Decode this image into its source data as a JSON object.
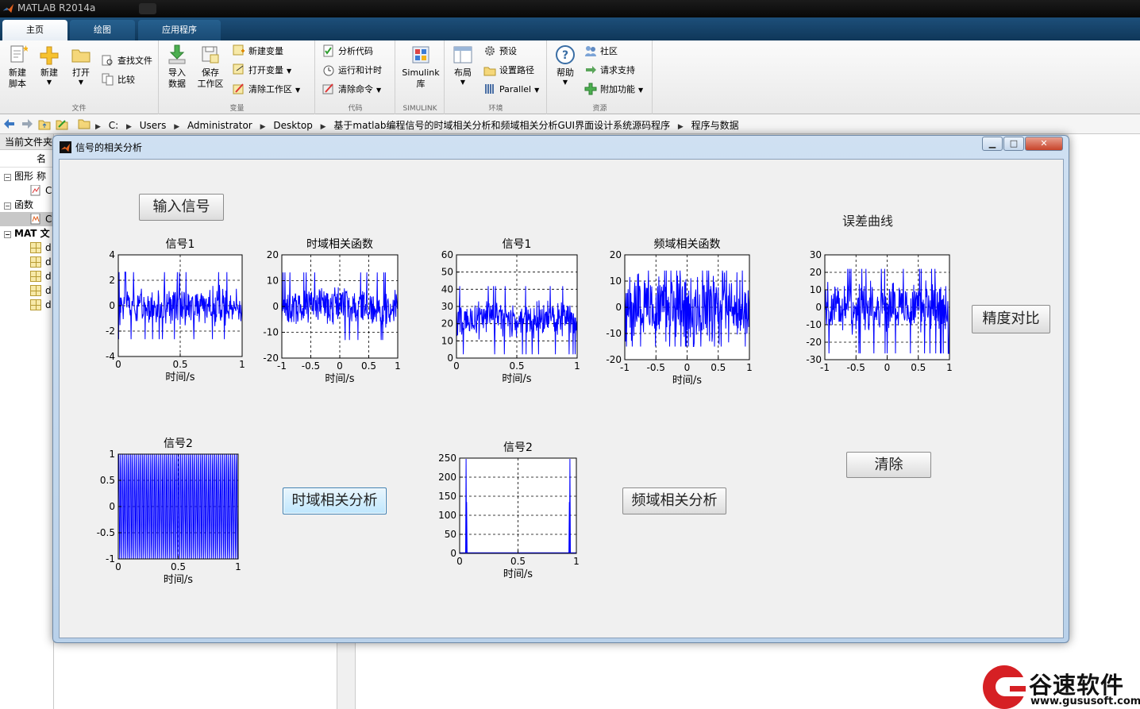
{
  "app": {
    "title": "MATLAB R2014a"
  },
  "ribbon": {
    "tabs": [
      "主页",
      "绘图",
      "应用程序"
    ],
    "file_group": {
      "label": "文件",
      "new_script": "新建\n脚本",
      "new": "新建",
      "open": "打开",
      "find_files": "查找文件",
      "compare": "比较"
    },
    "variable_group": {
      "label": "变量",
      "import_data": "导入\n数据",
      "save_workspace": "保存\n工作区",
      "new_variable": "新建变量",
      "open_variable": "打开变量",
      "clear_workspace": "清除工作区"
    },
    "code_group": {
      "label": "代码",
      "analyze_code": "分析代码",
      "run_and_time": "运行和计时",
      "clear_commands": "清除命令"
    },
    "simulink_group": {
      "label": "SIMULINK",
      "simulink": "Simulink\n库"
    },
    "environment_group": {
      "label": "环境",
      "layout": "布局",
      "preferences": "预设",
      "set_path": "设置路径",
      "parallel": "Parallel"
    },
    "resources_group": {
      "label": "资源",
      "help": "帮助",
      "community": "社区",
      "request_support": "请求支持",
      "addons": "附加功能"
    }
  },
  "address": {
    "segments": [
      "C:",
      "Users",
      "Administrator",
      "Desktop",
      "基于matlab编程信号的时域相关分析和频域相关分析GUI界面设计系统源码程序",
      "程序与数据"
    ]
  },
  "current_folder": {
    "header": "当前文件夹",
    "column_name": "名称",
    "groups": [
      {
        "label": "图形",
        "items": [
          "C"
        ]
      },
      {
        "label": "函数",
        "items": [
          "C"
        ]
      },
      {
        "label": "MAT 文",
        "items": [
          "d",
          "d",
          "d",
          "d",
          "d"
        ]
      }
    ]
  },
  "figure": {
    "title": "信号的相关分析",
    "buttons": {
      "input_signal": "输入信号",
      "time_corr": "时域相关分析",
      "freq_corr": "频域相关分析",
      "accuracy": "精度对比",
      "clear": "清除"
    },
    "error_curve_label": "误差曲线"
  },
  "chart_data": [
    {
      "id": "sig1-time",
      "type": "line",
      "title": "信号1",
      "xlabel": "时间/s",
      "ylabel": "",
      "xlim": [
        0,
        1
      ],
      "ylim": [
        -4,
        4
      ],
      "xticks": [
        0,
        0.5,
        1
      ],
      "yticks": [
        -4,
        -2,
        0,
        2,
        4
      ],
      "grid": true,
      "color": "#0000ff",
      "series": [
        {
          "kind": "noise",
          "center": 0,
          "amp": 1.2,
          "max": 3.6,
          "min": -3.2
        }
      ]
    },
    {
      "id": "time-corr",
      "type": "line",
      "title": "时域相关函数",
      "xlabel": "时间/s",
      "ylabel": "",
      "xlim": [
        -1,
        1
      ],
      "ylim": [
        -20,
        20
      ],
      "xticks": [
        -1,
        -0.5,
        0,
        0.5,
        1
      ],
      "yticks": [
        -20,
        -10,
        0,
        10,
        20
      ],
      "grid": true,
      "color": "#0000ff",
      "series": [
        {
          "kind": "noise",
          "center": 0,
          "amp": 6,
          "max": 15,
          "min": -13
        }
      ]
    },
    {
      "id": "sig1-freq",
      "type": "line",
      "title": "信号1",
      "xlabel": "时间/s",
      "ylabel": "",
      "xlim": [
        0,
        1
      ],
      "ylim": [
        0,
        60
      ],
      "xticks": [
        0,
        0.5,
        1
      ],
      "yticks": [
        0,
        10,
        20,
        30,
        40,
        50,
        60
      ],
      "grid": true,
      "color": "#0000ff",
      "series": [
        {
          "kind": "noise",
          "center": 22,
          "amp": 9,
          "max": 55,
          "min": 1
        }
      ]
    },
    {
      "id": "freq-corr",
      "type": "line",
      "title": "频域相关函数",
      "xlabel": "时间/s",
      "ylabel": "",
      "xlim": [
        -1,
        1
      ],
      "ylim": [
        -20,
        20
      ],
      "xticks": [
        -1,
        -0.5,
        0,
        0.5,
        1
      ],
      "yticks": [
        -20,
        -10,
        0,
        10,
        20
      ],
      "grid": true,
      "color": "#0000ff",
      "series": [
        {
          "kind": "noise",
          "center": 0,
          "amp": 11,
          "max": 14,
          "min": -15
        }
      ]
    },
    {
      "id": "error-curve",
      "type": "line",
      "title": "",
      "xlabel": "",
      "ylabel": "",
      "xlim": [
        -1,
        1
      ],
      "ylim": [
        -30,
        30
      ],
      "xticks": [
        -1,
        -0.5,
        0,
        0.5,
        1
      ],
      "yticks": [
        -30,
        -20,
        -10,
        0,
        10,
        20,
        30
      ],
      "grid": true,
      "color": "#0000ff",
      "series": [
        {
          "kind": "noise",
          "center": 0,
          "amp": 12,
          "max": 22,
          "min": -28
        }
      ]
    },
    {
      "id": "sig2-time",
      "type": "line",
      "title": "信号2",
      "xlabel": "时间/s",
      "ylabel": "",
      "xlim": [
        0,
        1
      ],
      "ylim": [
        -1,
        1
      ],
      "xticks": [
        0,
        0.5,
        1
      ],
      "yticks": [
        -1,
        -0.5,
        0,
        0.5,
        1
      ],
      "grid": true,
      "color": "#0000ff",
      "series": [
        {
          "kind": "sine",
          "freq": 60,
          "amp": 1
        }
      ]
    },
    {
      "id": "sig2-freq",
      "type": "line",
      "title": "信号2",
      "xlabel": "时间/s",
      "ylabel": "",
      "xlim": [
        0,
        1
      ],
      "ylim": [
        0,
        250
      ],
      "xticks": [
        0,
        0.5,
        1
      ],
      "yticks": [
        0,
        50,
        100,
        150,
        200,
        250
      ],
      "grid": true,
      "color": "#0000ff",
      "series": [
        {
          "kind": "spikes",
          "peaks": [
            [
              0.06,
              135
            ],
            [
              0.94,
              135
            ],
            [
              0.055,
              248
            ],
            [
              0.945,
              248
            ]
          ]
        }
      ]
    }
  ]
}
